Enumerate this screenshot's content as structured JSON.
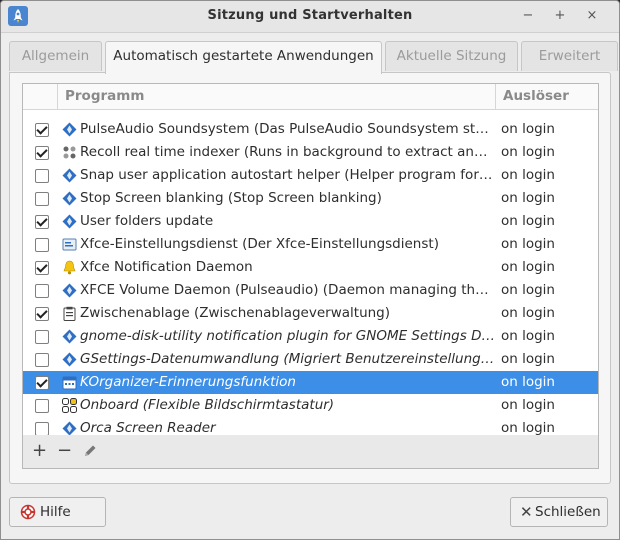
{
  "window": {
    "title": "Sitzung und Startverhalten",
    "app_icon": "rocket-icon",
    "controls": {
      "close": "×",
      "maximize": "+",
      "minimize": "−"
    }
  },
  "tabs": [
    {
      "label": "Allgemein",
      "active": false
    },
    {
      "label": "Automatisch gestartete Anwendungen",
      "active": true
    },
    {
      "label": "Aktuelle Sitzung",
      "active": false
    },
    {
      "label": "Erweitert",
      "active": false
    }
  ],
  "list": {
    "columns": {
      "program": "Programm",
      "trigger": "Auslöser"
    },
    "rows": [
      {
        "checked": true,
        "icon": "xfce-diamond-icon",
        "name": "PulseAudio Soundsystem (Das PulseAudio Soundsystem start...",
        "trigger": "on login",
        "italic": false
      },
      {
        "checked": true,
        "icon": "recoll-icon",
        "name": "Recoll real time indexer (Runs in background to extract and i...",
        "trigger": "on login",
        "italic": false
      },
      {
        "checked": false,
        "icon": "xfce-diamond-icon",
        "name": "Snap user application autostart helper (Helper program for la...",
        "trigger": "on login",
        "italic": false
      },
      {
        "checked": false,
        "icon": "xfce-diamond-icon",
        "name": "Stop Screen blanking (Stop Screen blanking)",
        "trigger": "on login",
        "italic": false
      },
      {
        "checked": true,
        "icon": "xfce-diamond-icon",
        "name": "User folders update",
        "trigger": "on login",
        "italic": false
      },
      {
        "checked": false,
        "icon": "settings-daemon-icon",
        "name": "Xfce-Einstellungsdienst (Der Xfce-Einstellungsdienst)",
        "trigger": "on login",
        "italic": false
      },
      {
        "checked": true,
        "icon": "bell-icon",
        "name": "Xfce Notification Daemon",
        "trigger": "on login",
        "italic": false
      },
      {
        "checked": false,
        "icon": "xfce-diamond-icon",
        "name": "XFCE Volume Daemon (Pulseaudio) (Daemon managing the v...",
        "trigger": "on login",
        "italic": false
      },
      {
        "checked": true,
        "icon": "clipboard-icon",
        "name": "Zwischenablage (Zwischenablageverwaltung)",
        "trigger": "on login",
        "italic": false
      },
      {
        "checked": false,
        "icon": "xfce-diamond-icon",
        "name": "gnome-disk-utility notification plugin for GNOME Settings Da...",
        "trigger": "on login",
        "italic": true
      },
      {
        "checked": false,
        "icon": "xfce-diamond-icon",
        "name": "GSettings-Datenumwandlung (Migriert Benutzereinstellungen...",
        "trigger": "on login",
        "italic": true
      },
      {
        "checked": true,
        "icon": "calendar-icon",
        "name": "KOrganizer-Erinnerungsfunktion",
        "trigger": "on login",
        "italic": true,
        "selected": true
      },
      {
        "checked": false,
        "icon": "keyboard-icon",
        "name": "Onboard (Flexible Bildschirmtastatur)",
        "trigger": "on login",
        "italic": true
      },
      {
        "checked": false,
        "icon": "xfce-diamond-icon",
        "name": "Orca Screen Reader",
        "trigger": "on login",
        "italic": true
      }
    ]
  },
  "toolbar": {
    "add": "+",
    "remove": "−",
    "edit": "edit-icon"
  },
  "buttons": {
    "help": "Hilfe",
    "close": "Schließen"
  },
  "colors": {
    "selection": "#3d8ee6",
    "accent_icon": "#2f6fc3",
    "bell": "#f3c414"
  }
}
